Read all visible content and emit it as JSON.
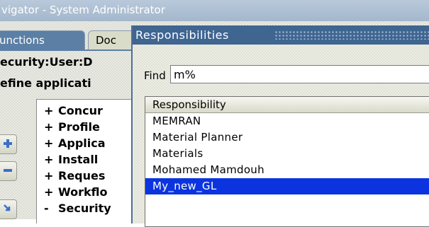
{
  "window": {
    "title": "vigator - System Administrator"
  },
  "tabs": [
    {
      "label": "unctions",
      "active": true
    },
    {
      "label": "Doc",
      "active": false
    }
  ],
  "navigator": {
    "user_label": "ecurity:User:D",
    "define_label": "efine applicati",
    "tree_items": [
      {
        "sign": "+",
        "label": "Concur"
      },
      {
        "sign": "+",
        "label": "Profile"
      },
      {
        "sign": "+",
        "label": "Applica"
      },
      {
        "sign": "+",
        "label": "Install"
      },
      {
        "sign": "+",
        "label": "Reques"
      },
      {
        "sign": "+",
        "label": "Workflo"
      },
      {
        "sign": "-",
        "label": "Security"
      }
    ],
    "side_buttons": [
      "expand-icon",
      "collapse-icon",
      "drill-down-icon"
    ]
  },
  "dialog": {
    "title": "Responsibilities",
    "find_label": "Find",
    "find_value": "m%",
    "column_header": "Responsibility",
    "rows": [
      "MEMRAN",
      "Material Planner",
      "Materials",
      "Mohamed Mamdouh",
      "My_new_GL"
    ],
    "selected_index": 4
  },
  "colors": {
    "title_bar": "#3f6591",
    "selection": "#0b34e0",
    "active_tab": "#5b7fa5"
  }
}
